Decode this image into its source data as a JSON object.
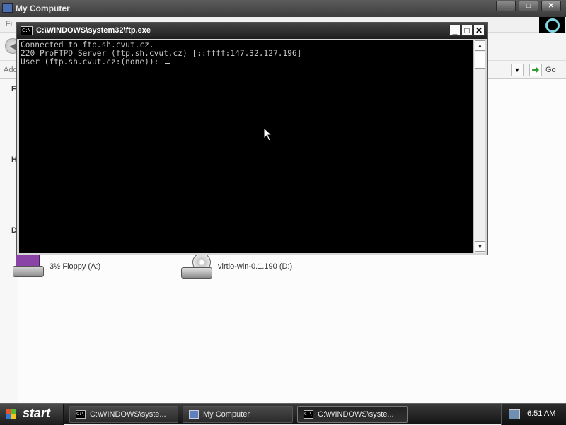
{
  "explorer": {
    "title": "My Computer",
    "menu_fragment": "Fi",
    "address_label": "Addr",
    "go_label": "Go",
    "side_fragments": [
      "F",
      "H",
      "D"
    ],
    "drives": [
      {
        "label": "3½ Floppy (A:)",
        "icon": "floppy-drive-icon"
      },
      {
        "label": "virtio-win-0.1.190 (D:)",
        "icon": "cd-drive-icon"
      }
    ]
  },
  "console": {
    "title": "C:\\WINDOWS\\system32\\ftp.exe",
    "icon_text": "C:\\",
    "lines": [
      "Connected to ftp.sh.cvut.cz.",
      "220 ProFTPD Server (ftp.sh.cvut.cz) [::ffff:147.32.127.196]",
      "User (ftp.sh.cvut.cz:(none)): "
    ],
    "minimize_label": "_",
    "maximize_label": "□",
    "close_label": "✕"
  },
  "taskbar": {
    "start_label": "start",
    "tasks": [
      {
        "label": "C:\\WINDOWS\\syste...",
        "icon": "console-icon",
        "active": false
      },
      {
        "label": "My Computer",
        "icon": "computer-icon",
        "active": false
      },
      {
        "label": "C:\\WINDOWS\\syste...",
        "icon": "console-icon",
        "active": true
      }
    ],
    "clock": "6:51 AM"
  },
  "colors": {
    "console_bg": "#000000",
    "console_text": "#c8c8c8",
    "titlebar_dark": "#1e1e1e",
    "taskbar": "#141414"
  }
}
